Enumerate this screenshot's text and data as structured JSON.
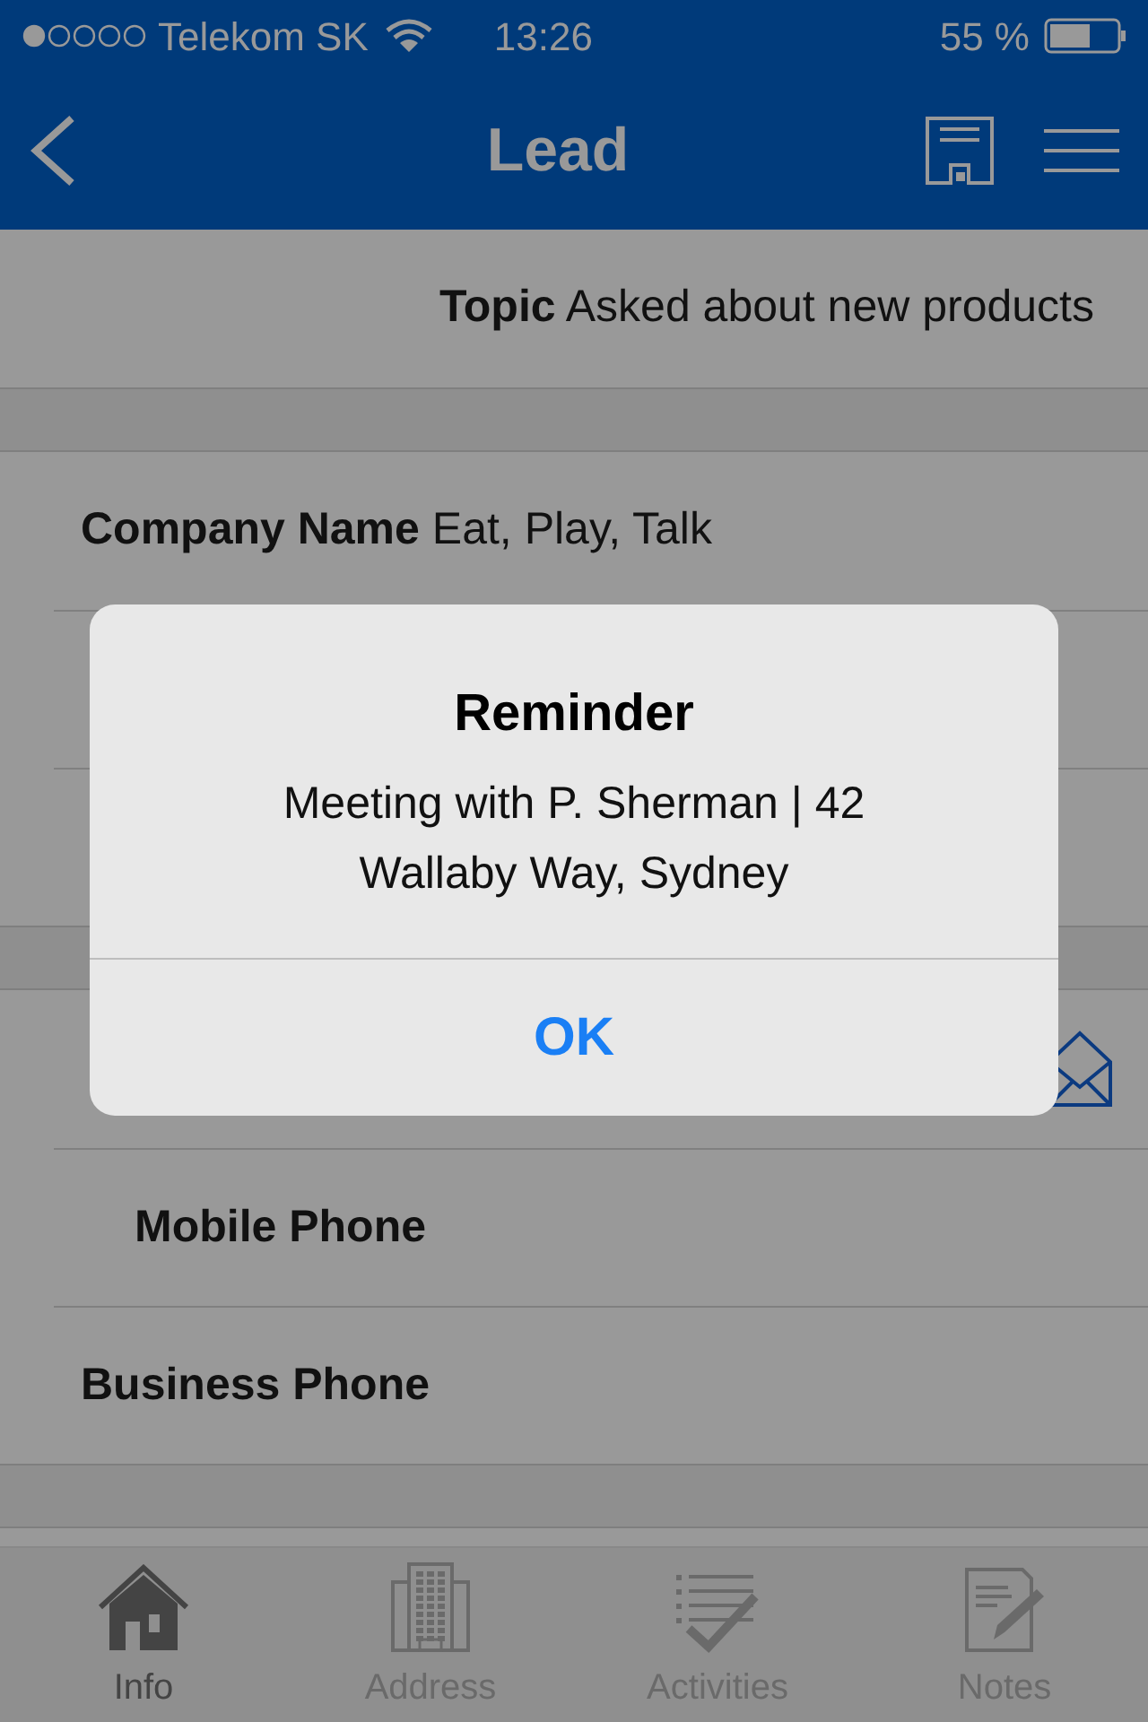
{
  "status_bar": {
    "carrier": "Telekom SK",
    "time": "13:26",
    "battery": "55 %"
  },
  "nav": {
    "title": "Lead"
  },
  "sections": [
    {
      "rows": [
        {
          "kind": "topic",
          "label": "Topic",
          "value": "Asked about new products"
        }
      ]
    },
    {
      "rows": [
        {
          "kind": "field",
          "label": "Company Name",
          "value": "Eat, Play, Talk"
        },
        {
          "kind": "field"
        },
        {
          "kind": "field"
        }
      ]
    },
    {
      "rows": [
        {
          "kind": "email"
        },
        {
          "kind": "indented",
          "label": "Mobile Phone"
        },
        {
          "kind": "field",
          "label": "Business Phone"
        }
      ]
    }
  ],
  "tabs": [
    {
      "label": "Info",
      "kind": "home",
      "selected": true
    },
    {
      "label": "Address",
      "kind": "building",
      "selected": false
    },
    {
      "label": "Activities",
      "kind": "checklist",
      "selected": false
    },
    {
      "label": "Notes",
      "kind": "note",
      "selected": false
    }
  ],
  "alert": {
    "title": "Reminder",
    "message": "Meeting with P. Sherman | 42 Wallaby Way, Sydney",
    "button": "OK"
  }
}
